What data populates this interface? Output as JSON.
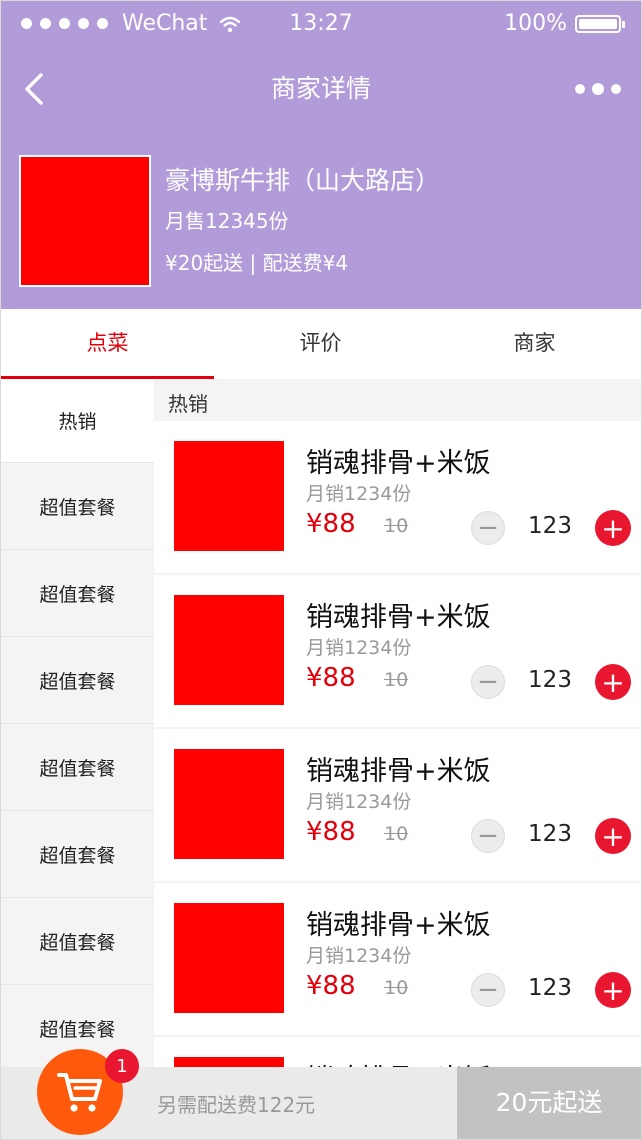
{
  "status_bar": {
    "carrier": "WeChat",
    "time": "13:27",
    "battery": "100%"
  },
  "nav": {
    "title": "商家详情"
  },
  "shop": {
    "name": "豪博斯牛排（山大路店）",
    "monthly_sales": "月售12345份",
    "delivery_info": "¥20起送 | 配送费¥4",
    "image_color": "#ff0000"
  },
  "tabs": [
    {
      "label": "点菜",
      "active": true
    },
    {
      "label": "评价",
      "active": false
    },
    {
      "label": "商家",
      "active": false
    }
  ],
  "sidebar": [
    {
      "label": "热销",
      "active": true
    },
    {
      "label": "超值套餐"
    },
    {
      "label": "超值套餐"
    },
    {
      "label": "超值套餐"
    },
    {
      "label": "超值套餐"
    },
    {
      "label": "超值套餐"
    },
    {
      "label": "超值套餐"
    },
    {
      "label": "超值套餐"
    }
  ],
  "section": {
    "title": "热销"
  },
  "dishes": [
    {
      "name": "销魂排骨+米饭",
      "sales": "月销1234份",
      "price": "¥88",
      "old_price": "10",
      "qty": "123"
    },
    {
      "name": "销魂排骨+米饭",
      "sales": "月销1234份",
      "price": "¥88",
      "old_price": "10",
      "qty": "123"
    },
    {
      "name": "销魂排骨+米饭",
      "sales": "月销1234份",
      "price": "¥88",
      "old_price": "10",
      "qty": "123"
    },
    {
      "name": "销魂排骨+米饭",
      "sales": "月销1234份",
      "price": "¥88",
      "old_price": "10",
      "qty": "123"
    },
    {
      "name": "销魂排骨+米饭",
      "sales": "",
      "price": "",
      "old_price": "",
      "qty": ""
    }
  ],
  "controls": {
    "minus": "−",
    "plus": "+"
  },
  "cart": {
    "badge": "1",
    "icon": "cart-icon",
    "color": "#ff5a0c"
  },
  "footer": {
    "note": "另需配送费122元",
    "button": "20元起送"
  },
  "colors": {
    "header": "#b19cd9",
    "accent": "#e3000b",
    "plus": "#e8162e"
  }
}
